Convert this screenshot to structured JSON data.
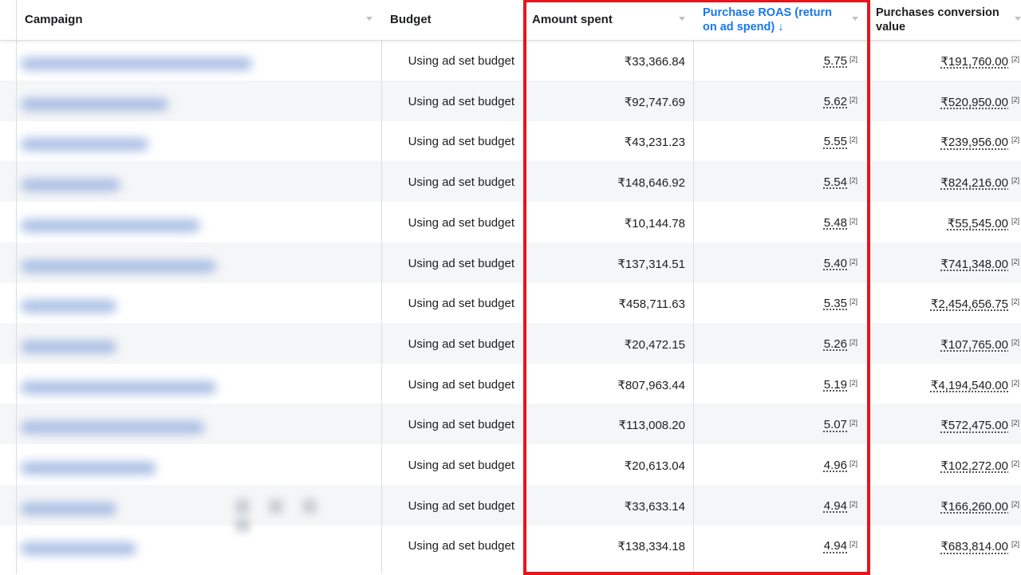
{
  "columns": {
    "campaign": "Campaign",
    "budget": "Budget",
    "amount_spent": "Amount spent",
    "roas_line1": "Purchase ROAS (return",
    "roas_line2": "on ad spend) ↓",
    "pcv_line1": "Purchases conversion",
    "pcv_line2": "value"
  },
  "colors": {
    "sorted_header": "#1877f2",
    "highlight_box": "#e8141b",
    "alt_row": "#f5f6f7"
  },
  "footnote_marker": "[2]",
  "rows": [
    {
      "budget": "Using ad set budget",
      "amount": "₹33,366.84",
      "roas": "5.75",
      "pcv": "₹191,760.00"
    },
    {
      "budget": "Using ad set budget",
      "amount": "₹92,747.69",
      "roas": "5.62",
      "pcv": "₹520,950.00"
    },
    {
      "budget": "Using ad set budget",
      "amount": "₹43,231.23",
      "roas": "5.55",
      "pcv": "₹239,956.00"
    },
    {
      "budget": "Using ad set budget",
      "amount": "₹148,646.92",
      "roas": "5.54",
      "pcv": "₹824,216.00"
    },
    {
      "budget": "Using ad set budget",
      "amount": "₹10,144.78",
      "roas": "5.48",
      "pcv": "₹55,545.00"
    },
    {
      "budget": "Using ad set budget",
      "amount": "₹137,314.51",
      "roas": "5.40",
      "pcv": "₹741,348.00"
    },
    {
      "budget": "Using ad set budget",
      "amount": "₹458,711.63",
      "roas": "5.35",
      "pcv": "₹2,454,656.75"
    },
    {
      "budget": "Using ad set budget",
      "amount": "₹20,472.15",
      "roas": "5.26",
      "pcv": "₹107,765.00"
    },
    {
      "budget": "Using ad set budget",
      "amount": "₹807,963.44",
      "roas": "5.19",
      "pcv": "₹4,194,540.00"
    },
    {
      "budget": "Using ad set budget",
      "amount": "₹113,008.20",
      "roas": "5.07",
      "pcv": "₹572,475.00"
    },
    {
      "budget": "Using ad set budget",
      "amount": "₹20,613.04",
      "roas": "4.96",
      "pcv": "₹102,272.00"
    },
    {
      "budget": "Using ad set budget",
      "amount": "₹33,633.14",
      "roas": "4.94",
      "pcv": "₹166,260.00"
    },
    {
      "budget": "Using ad set budget",
      "amount": "₹138,334.18",
      "roas": "4.94",
      "pcv": "₹683,814.00"
    }
  ]
}
